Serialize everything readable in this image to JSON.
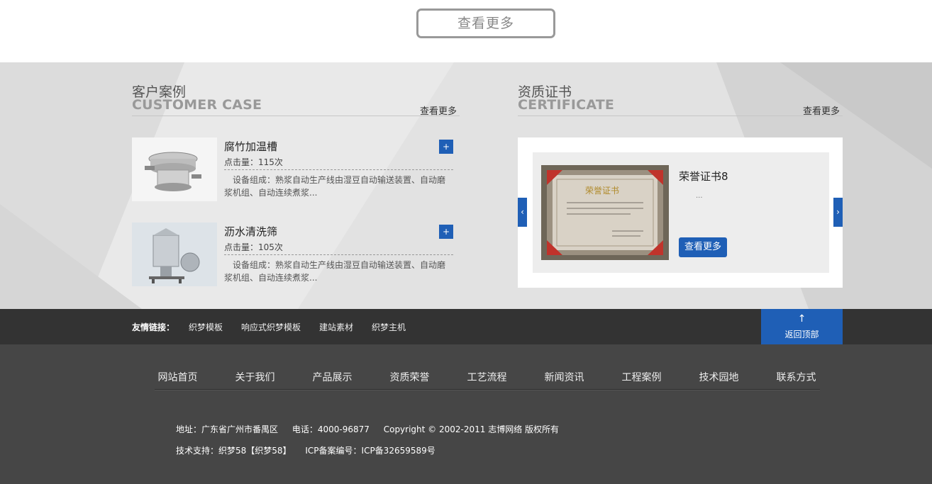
{
  "top": {
    "more_button": "查看更多"
  },
  "cases": {
    "title_cn": "客户案例",
    "title_en": "CUSTOMER CASE",
    "more": "查看更多",
    "items": [
      {
        "name": "腐竹加温槽",
        "hits": "点击量：115次",
        "desc": "设备组成：熟浆自动生产线由湿豆自动输送装置、自动磨浆机组、自动连续煮浆...",
        "plus": "+"
      },
      {
        "name": "沥水清洗筛",
        "hits": "点击量：105次",
        "desc": "设备组成：熟浆自动生产线由湿豆自动输送装置、自动磨浆机组、自动连续煮浆...",
        "plus": "+"
      }
    ]
  },
  "certs": {
    "title_cn": "资质证书",
    "title_en": "CERTIFICATE",
    "more": "查看更多",
    "item": {
      "name": "荣誉证书8",
      "dots": "...",
      "button": "查看更多"
    },
    "prev": "‹",
    "next": "›"
  },
  "links": {
    "label": "友情链接：",
    "items": [
      "织梦模板",
      "响应式织梦模板",
      "建站素材",
      "织梦主机"
    ],
    "back_top_arrow": "↑",
    "back_top": "返回顶部"
  },
  "footer": {
    "nav": [
      "网站首页",
      "关于我们",
      "产品展示",
      "资质荣誉",
      "工艺流程",
      "新闻资讯",
      "工程案例",
      "技术园地",
      "联系方式"
    ],
    "address": "地址：广东省广州市番禺区",
    "phone": "电话：4000-96877",
    "copyright": "Copyright © 2002-2011 志博网络 版权所有",
    "support": "技术支持：织梦58【织梦58】",
    "icp": "ICP备案编号：ICP备32659589号"
  },
  "colors": {
    "accent": "#1f5fb6",
    "links_bar": "#333333",
    "footer": "#464646"
  }
}
